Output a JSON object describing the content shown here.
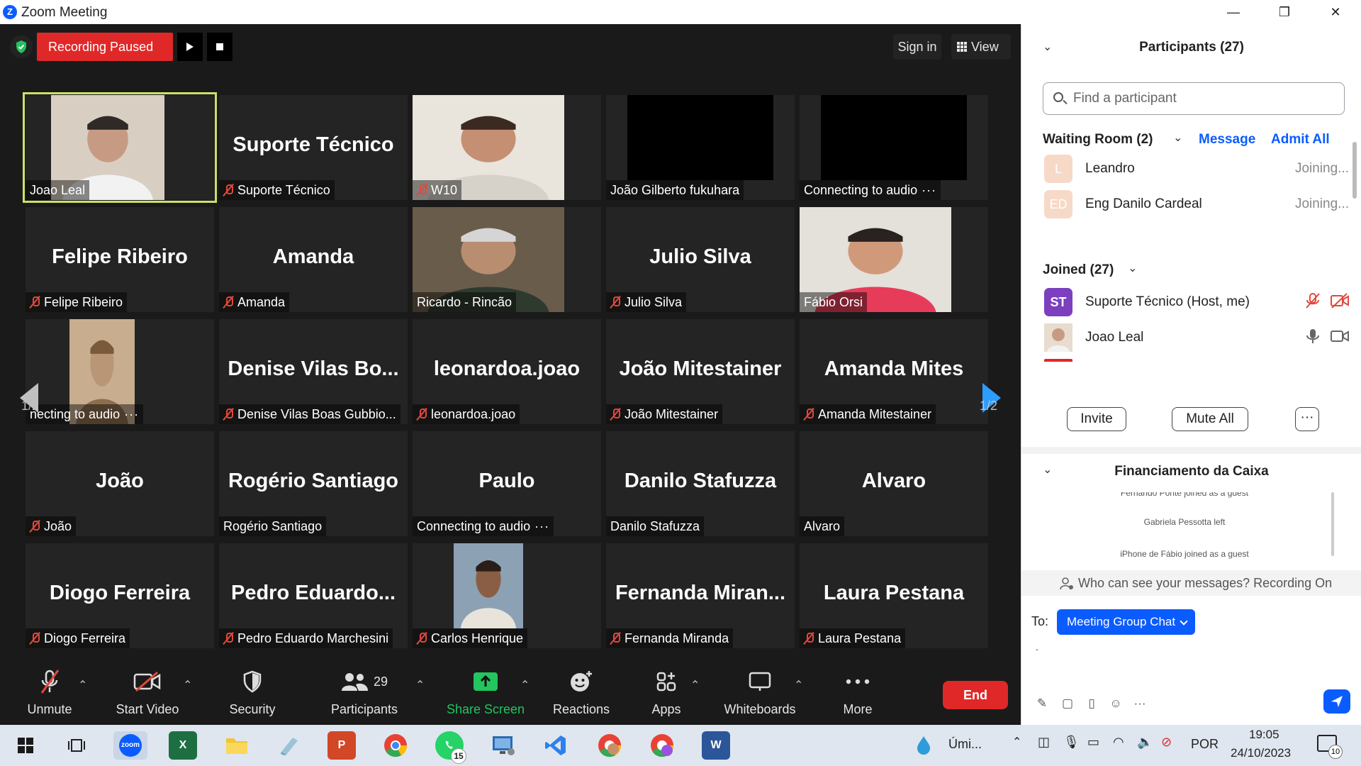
{
  "window": {
    "title": "Zoom Meeting",
    "logo": "Z",
    "minimize": "—",
    "restore": "❐",
    "close": "✕"
  },
  "recording": {
    "status": "Recording Paused"
  },
  "topbar": {
    "sign_in": "Sign in",
    "view": "View"
  },
  "gallery": {
    "page_left": "1/2",
    "page_right": "1/2",
    "tiles": [
      {
        "label": "Joao Leal",
        "muted": false,
        "video": true
      },
      {
        "big": "Suporte Técnico",
        "label": "Suporte Técnico",
        "muted": true
      },
      {
        "label": "W10",
        "muted": true,
        "video": true
      },
      {
        "label": "João Gilberto fukuhara",
        "muted": false,
        "black": true
      },
      {
        "label": "Connecting to audio",
        "muted": false,
        "black": true,
        "dots": "···"
      },
      {
        "big": "Felipe Ribeiro",
        "label": "Felipe Ribeiro",
        "muted": true
      },
      {
        "big": "Amanda",
        "label": "Amanda",
        "muted": true
      },
      {
        "label": "Ricardo - Rincão",
        "muted": false,
        "video": true
      },
      {
        "big": "Julio Silva",
        "label": "Julio Silva",
        "muted": true
      },
      {
        "label": "Fábio Orsi",
        "muted": false,
        "video": true
      },
      {
        "label": "necting to audio",
        "muted": false,
        "video": true,
        "dots": "···"
      },
      {
        "big": "Denise Vilas Bo...",
        "label": "Denise Vilas Boas Gubbio...",
        "muted": true
      },
      {
        "big": "leonardoa.joao",
        "label": "leonardoa.joao",
        "muted": true
      },
      {
        "big": "João Mitestainer",
        "label": "João Mitestainer",
        "muted": true
      },
      {
        "big": "Amanda  Mites",
        "label": "Amanda Mitestainer",
        "muted": true
      },
      {
        "big": "João",
        "label": "João",
        "muted": true
      },
      {
        "big": "Rogério Santiago",
        "label": "Rogério Santiago",
        "muted": false
      },
      {
        "big": "Paulo",
        "label": "Connecting to audio",
        "muted": false,
        "dots": "···"
      },
      {
        "big": "Danilo Stafuzza",
        "label": "Danilo Stafuzza",
        "muted": false
      },
      {
        "big": "Alvaro",
        "label": "Alvaro",
        "muted": false
      },
      {
        "big": "Diogo Ferreira",
        "label": "Diogo Ferreira",
        "muted": true
      },
      {
        "big": "Pedro  Eduardo...",
        "label": "Pedro Eduardo Marchesini",
        "muted": true
      },
      {
        "label": "Carlos Henrique",
        "muted": true,
        "video": true
      },
      {
        "big": "Fernanda  Miran...",
        "label": "Fernanda Miranda",
        "muted": true
      },
      {
        "big": "Laura Pestana",
        "label": "Laura Pestana",
        "muted": true
      }
    ]
  },
  "toolbar": {
    "unmute": "Unmute",
    "start_video": "Start Video",
    "security": "Security",
    "participants": "Participants",
    "participants_count": "29",
    "share_screen": "Share Screen",
    "reactions": "Reactions",
    "apps": "Apps",
    "whiteboards": "Whiteboards",
    "more": "More",
    "end": "End"
  },
  "participants_panel": {
    "title": "Participants (27)",
    "search_placeholder": "Find a participant",
    "waiting_room": "Waiting Room (2)",
    "message": "Message",
    "admit_all": "Admit All",
    "waiting": [
      {
        "initials": "L",
        "name": "Leandro",
        "status": "Joining...",
        "color": "#f7d9c7"
      },
      {
        "initials": "ED",
        "name": "Eng  Danilo Cardeal",
        "status": "Joining...",
        "color": "#f7d9c7"
      }
    ],
    "joined": "Joined (27)",
    "joined_list": [
      {
        "initials": "ST",
        "name": "Suporte Técnico (Host, me)",
        "color": "#7b3fbf"
      },
      {
        "initials": "",
        "name": "Joao Leal",
        "color": "#a07a5a"
      }
    ],
    "invite": "Invite",
    "mute_all": "Mute All",
    "more": "···"
  },
  "chat": {
    "title": "Financiamento da Caixa",
    "messages": [
      "Fernando Ponte joined as a guest",
      "Gabriela Pessotta left",
      "iPhone de Fábio joined as a guest"
    ],
    "who_can_see": "Who can see your messages? Recording On",
    "to_label": "To:",
    "to_value": "Meeting Group Chat"
  },
  "taskbar": {
    "weather": "Úmi...",
    "language": "POR",
    "time": "19:05",
    "date": "24/10/2023",
    "whatsapp_badge": "15",
    "notif_badge": "10",
    "zoom": "zoom"
  },
  "colors": {
    "accent": "#0b5cff",
    "end": "#e02828",
    "active_border": "#cbe06a",
    "share": "#22c55e"
  }
}
